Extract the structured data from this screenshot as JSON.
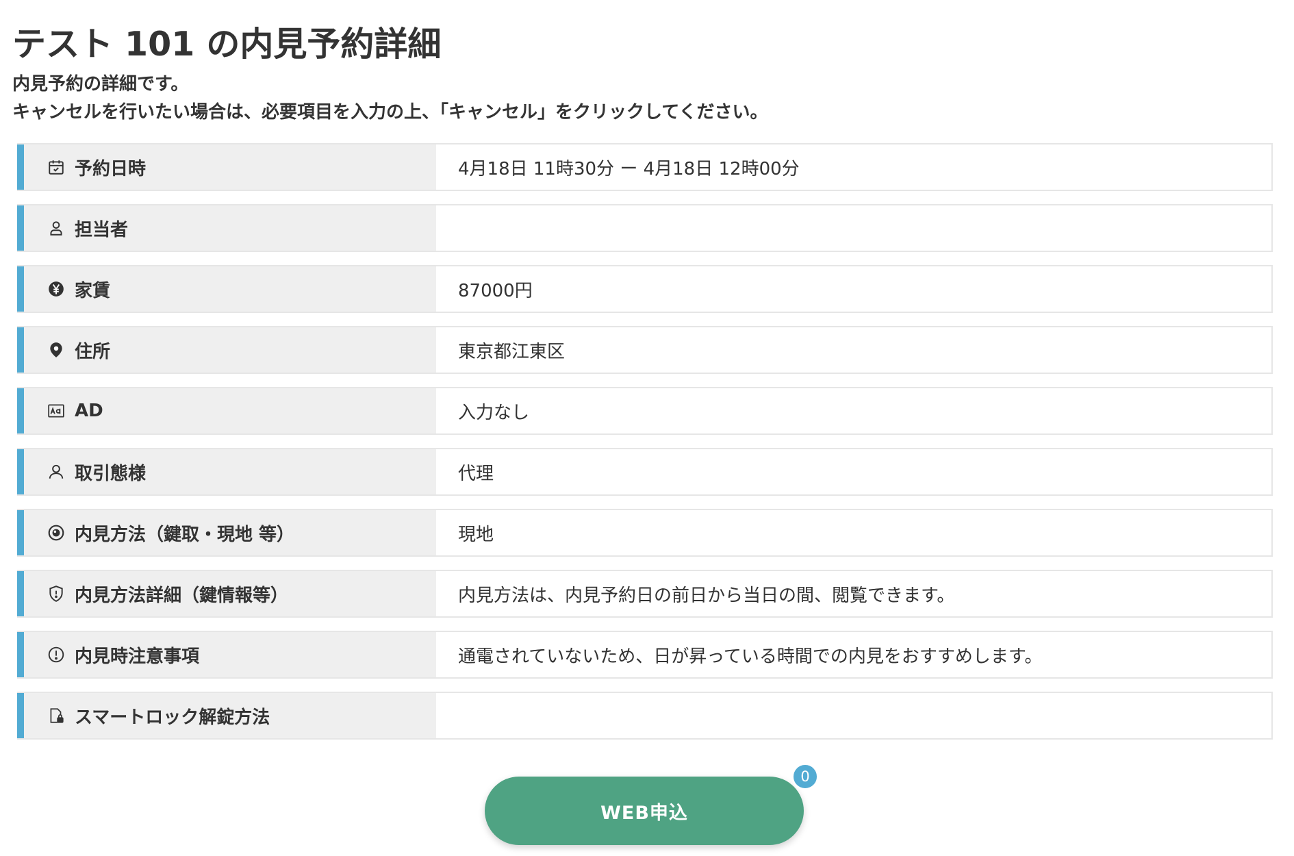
{
  "page": {
    "title": "テスト 101 の内見予約詳細",
    "description_line1": "内見予約の詳細です。",
    "description_line2": "キャンセルを行いたい場合は、必要項目を入力の上、「キャンセル」をクリックしてください。"
  },
  "details": [
    {
      "icon": "calendar-icon",
      "label": "予約日時",
      "value": "4月18日 11時30分 ー 4月18日 12時00分"
    },
    {
      "icon": "person-icon",
      "label": "担当者",
      "value": ""
    },
    {
      "icon": "yen-icon",
      "label": "家賃",
      "value": "87000円"
    },
    {
      "icon": "location-pin-icon",
      "label": "住所",
      "value": "東京都江東区"
    },
    {
      "icon": "ad-icon",
      "label": "AD",
      "value": "入力なし"
    },
    {
      "icon": "user-icon",
      "label": "取引態様",
      "value": "代理"
    },
    {
      "icon": "eye-icon",
      "label": "内見方法（鍵取・現地 等）",
      "value": "現地"
    },
    {
      "icon": "shield-icon",
      "label": "内見方法詳細（鍵情報等）",
      "value": "内見方法は、内見予約日の前日から当日の間、閲覧できます。"
    },
    {
      "icon": "alert-circle-icon",
      "label": "内見時注意事項",
      "value": "通電されていないため、日が昇っている時間での内見をおすすめします。"
    },
    {
      "icon": "smart-lock-icon",
      "label": "スマートロック解錠方法",
      "value": ""
    }
  ],
  "web_apply": {
    "label": "WEB申込",
    "badge_count": "0"
  },
  "colors": {
    "accent": "#52abd3",
    "button": "#4fa383",
    "label_bg": "#efefef"
  }
}
